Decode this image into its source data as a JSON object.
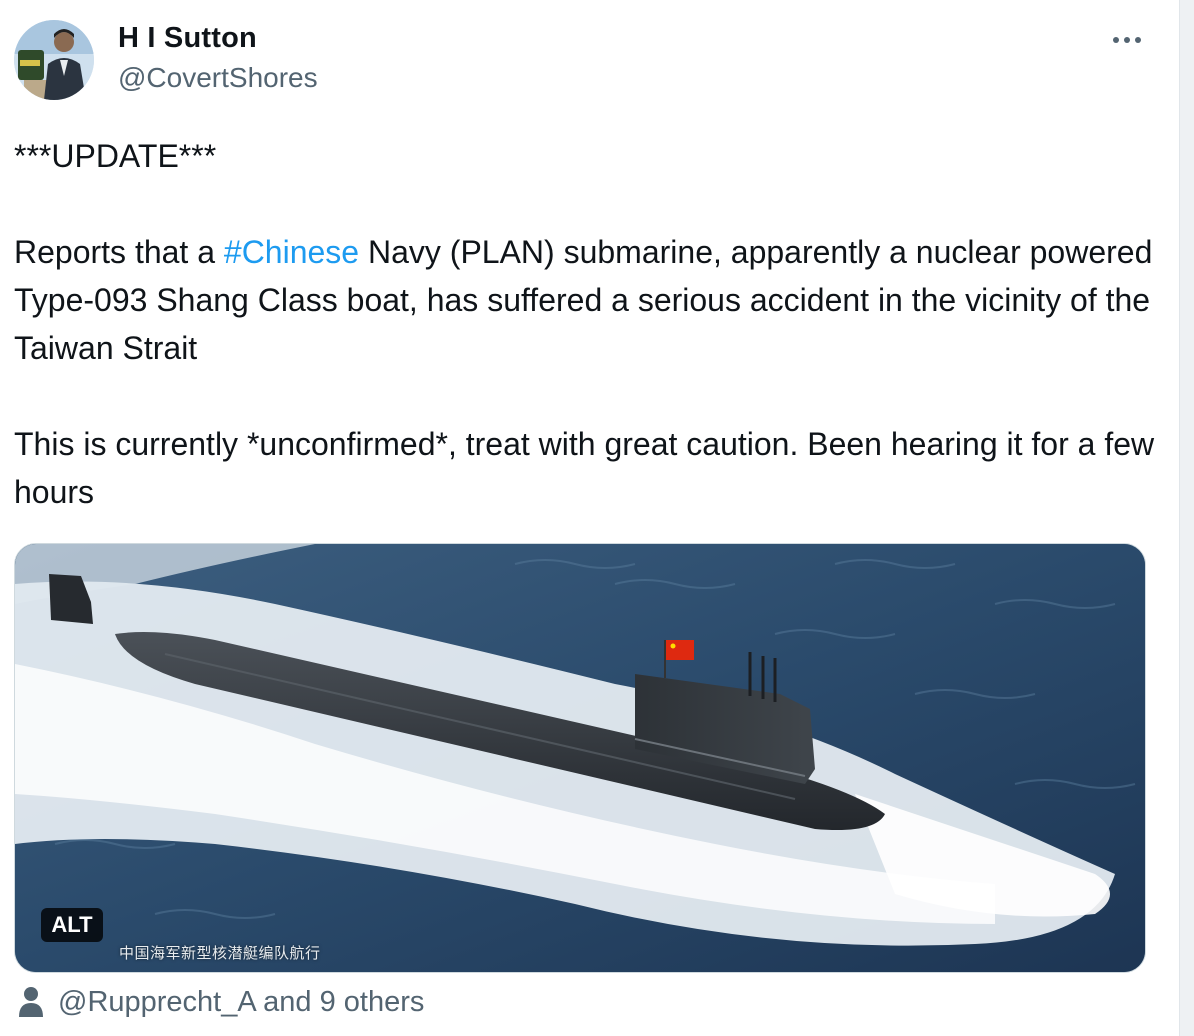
{
  "author": {
    "name": "H I Sutton",
    "handle": "@CovertShores"
  },
  "tweet": {
    "line1": "***UPDATE***",
    "p2_before": "Reports that a ",
    "p2_hashtag": "#Chinese",
    "p2_after": " Navy (PLAN) submarine, apparently a nuclear powered Type-093 Shang Class boat, has suffered a serious accident in the vicinity of the Taiwan Strait",
    "p3": "This is currently *unconfirmed*, treat with great caution. Been hearing it for a few hours"
  },
  "media": {
    "alt_label": "ALT",
    "caption": "中国海军新型核潜艇编队航行"
  },
  "tagged": {
    "text": "@Rupprecht_A and 9 others"
  },
  "icons": {
    "more": "more-horizontal-icon",
    "tagged": "person-icon"
  },
  "colors": {
    "hashtag": "#1d9bf0",
    "secondary_text": "#536471",
    "primary_text": "#0f1419"
  }
}
